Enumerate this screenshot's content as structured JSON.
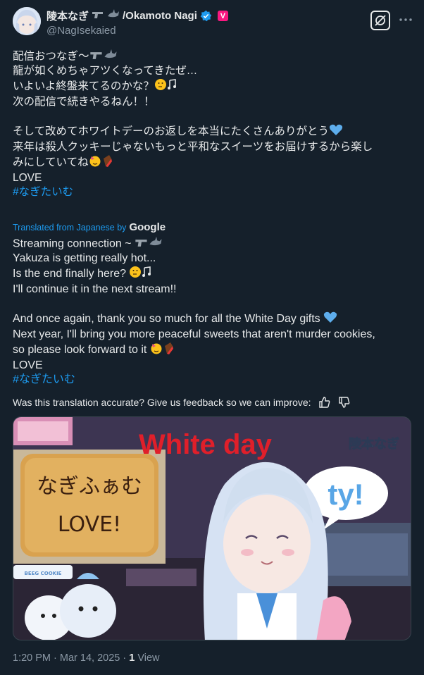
{
  "header": {
    "display_name": "陵本なぎ",
    "name_suffix": "/Okamoto Nagi",
    "handle": "@NagIsekaied",
    "sub_badge": "V"
  },
  "icons": {
    "verified": "verified-badge-icon",
    "grok": "grok-icon",
    "more": "more-icon",
    "thumbs_up": "thumbs-up-icon",
    "thumbs_down": "thumbs-down-icon"
  },
  "original": {
    "line1": "配信おつなぎ〜",
    "line2": "龍が如くめちゃアツくなってきたぜ…",
    "line3": "いよいよ終盤来てるのかな？",
    "line4": "次の配信で続きやるねん！！",
    "line5": "そして改めてホワイトデーのお返しを本当にたくさんありがとう",
    "line6": "来年は殺人クッキーじゃないもっと平和なスイーツをお届けするから楽し",
    "line7": "みにしていてね",
    "line8": "LOVE",
    "hashtag": "#なぎたいむ"
  },
  "translation_label": "Translated from Japanese by",
  "translation_provider": "Google",
  "translated": {
    "line1": "Streaming connection ~",
    "line2": "Yakuza is getting really hot...",
    "line3": "Is the end finally here?",
    "line4": "I'll continue it in the next stream!!",
    "line5": "And once again, thank you so much for all the White Day gifts",
    "line6": "Next year, I'll bring you more peaceful sweets that aren't murder cookies,",
    "line7": "so please look forward to it",
    "line8": "LOVE",
    "hashtag": "#なぎたいむ"
  },
  "feedback_text": "Was this translation accurate? Give us feedback so we can improve:",
  "media": {
    "headline": "White day",
    "bubble": "ty!",
    "cookie_line1": "なぎふぁむ",
    "cookie_line2": "LOVE!",
    "logo_text": "陵本なぎ",
    "sticker_text": "BEEG COOKIE"
  },
  "footer": {
    "time": "1:20 PM · Mar 14, 2025 ·",
    "views_count": "1",
    "views_label": "View"
  }
}
